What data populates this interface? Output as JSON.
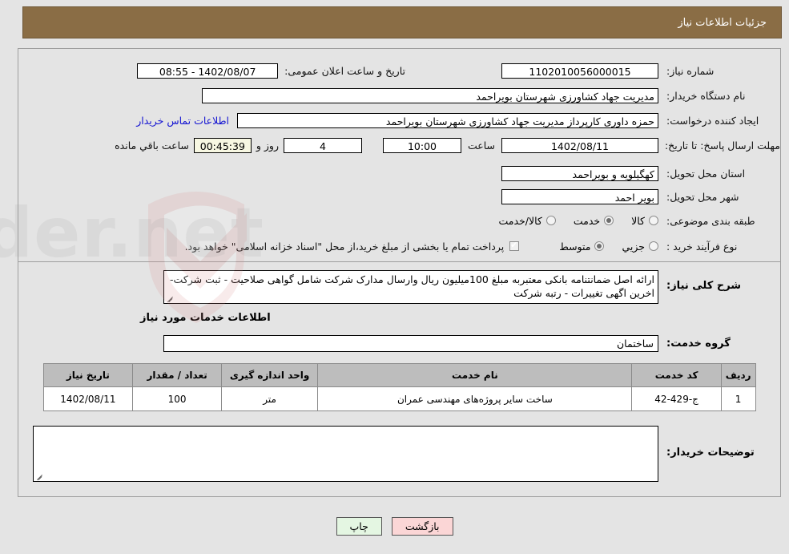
{
  "header": {
    "title": "جزئیات اطلاعات نیاز"
  },
  "fields": {
    "need_number_label": "شماره نیاز:",
    "need_number_value": "1102010056000015",
    "public_announce_label": "تاریخ و ساعت اعلان عمومی:",
    "public_announce_value": "08:55 - 1402/08/07",
    "buyer_org_label": "نام دستگاه خریدار:",
    "buyer_org_value": "مدیریت جهاد کشاورزی شهرستان بویراحمد",
    "requester_label": "ایجاد کننده درخواست:",
    "requester_value": "حمزه داوری کارپرداز مدیریت جهاد کشاورزی شهرستان بویراحمد",
    "contact_link": "اطلاعات تماس خریدار",
    "deadline_label": "مهلت ارسال پاسخ: تا تاریخ:",
    "deadline_date": "1402/08/11",
    "time_label": "ساعت",
    "deadline_time": "10:00",
    "days_remaining": "4",
    "days_word": "روز و",
    "hours_remaining": "00:45:39",
    "remaining_suffix": "ساعت باقي مانده",
    "province_label": "استان محل تحویل:",
    "province_value": "کهگیلویه و بویراحمد",
    "city_label": "شهر محل تحویل:",
    "city_value": "بویر احمد",
    "category_label": "طبقه بندی موضوعی:",
    "process_label": "نوع فرآیند خرید :",
    "treasury_note": "پرداخت تمام یا بخشی از مبلغ خرید،از محل \"اسناد خزانه اسلامی\" خواهد بود."
  },
  "category_options": [
    {
      "label": "کالا",
      "selected": false
    },
    {
      "label": "خدمت",
      "selected": true
    },
    {
      "label": "کالا/خدمت",
      "selected": false
    }
  ],
  "process_options": [
    {
      "label": "جزیي",
      "selected": false
    },
    {
      "label": "متوسط",
      "selected": true
    }
  ],
  "treasury_checkbox_checked": true,
  "description": {
    "label": "شرح کلی نیاز:",
    "value": "ارائه اصل ضمانتنامه بانکی معتبربه مبلغ  100میلیون ریال  وارسال مدارک شرکت شامل گواهی صلاحیت - ثبت شرکت- اخرین اگهی تغییرات - رتبه شرکت"
  },
  "services_section": {
    "title": "اطلاعات خدمات مورد نیاز",
    "group_label": "گروه خدمت:",
    "group_value": "ساختمان"
  },
  "table": {
    "headers": [
      "ردیف",
      "کد خدمت",
      "نام خدمت",
      "واحد اندازه گیری",
      "تعداد / مقدار",
      "تاریخ نیاز"
    ],
    "rows": [
      {
        "row_no": "1",
        "service_code": "ج-429-42",
        "service_name": "ساخت سایر پروژه‌های مهندسی عمران",
        "unit": "متر",
        "quantity": "100",
        "need_date": "1402/08/11"
      }
    ]
  },
  "buyer_notes": {
    "label": "توضیحات خریدار:",
    "value": ""
  },
  "buttons": {
    "back": "بازگشت",
    "print": "چاپ"
  },
  "colors": {
    "header_bg": "#8a6d45",
    "page_bg": "#e4e4e4",
    "link": "#1414d2",
    "back_btn": "#fbd6d6",
    "print_btn": "#e4f6e2",
    "highlight_field": "#f7f7e2",
    "table_header": "#bdbdbd"
  }
}
